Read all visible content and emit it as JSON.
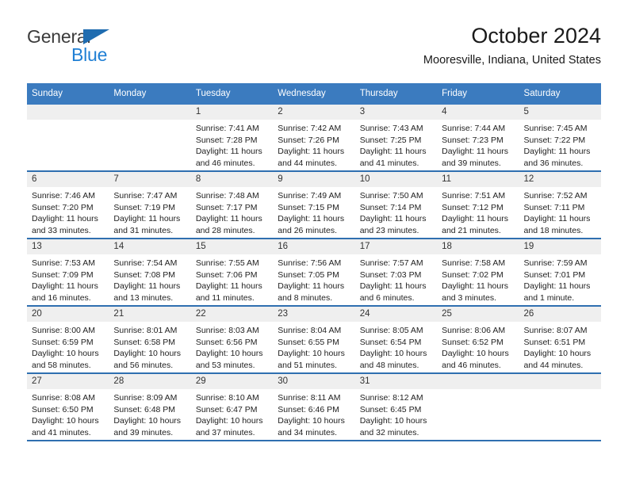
{
  "brand": {
    "name_top": "General",
    "name_bottom": "Blue",
    "triangle_color": "#1f6cb0",
    "text_color_top": "#3b3b3b",
    "text_color_bottom": "#1f7fd4"
  },
  "header": {
    "title": "October 2024",
    "subtitle": "Mooresville, Indiana, United States"
  },
  "theme": {
    "header_bg": "#3b7bbf",
    "row_border": "#2f6fb0",
    "daynum_bg": "#efefef",
    "page_bg": "#ffffff"
  },
  "labels": {
    "sunrise_prefix": "Sunrise:",
    "sunset_prefix": "Sunset:",
    "daylight_prefix": "Daylight:"
  },
  "weekdays": [
    "Sunday",
    "Monday",
    "Tuesday",
    "Wednesday",
    "Thursday",
    "Friday",
    "Saturday"
  ],
  "weeks": [
    [
      {
        "day": "",
        "empty": true,
        "sunrise": "",
        "sunset": "",
        "daylight_line1": "",
        "daylight_line2": ""
      },
      {
        "day": "",
        "empty": true,
        "sunrise": "",
        "sunset": "",
        "daylight_line1": "",
        "daylight_line2": ""
      },
      {
        "day": "1",
        "sunrise": "Sunrise: 7:41 AM",
        "sunset": "Sunset: 7:28 PM",
        "daylight_line1": "Daylight: 11 hours",
        "daylight_line2": "and 46 minutes."
      },
      {
        "day": "2",
        "sunrise": "Sunrise: 7:42 AM",
        "sunset": "Sunset: 7:26 PM",
        "daylight_line1": "Daylight: 11 hours",
        "daylight_line2": "and 44 minutes."
      },
      {
        "day": "3",
        "sunrise": "Sunrise: 7:43 AM",
        "sunset": "Sunset: 7:25 PM",
        "daylight_line1": "Daylight: 11 hours",
        "daylight_line2": "and 41 minutes."
      },
      {
        "day": "4",
        "sunrise": "Sunrise: 7:44 AM",
        "sunset": "Sunset: 7:23 PM",
        "daylight_line1": "Daylight: 11 hours",
        "daylight_line2": "and 39 minutes."
      },
      {
        "day": "5",
        "sunrise": "Sunrise: 7:45 AM",
        "sunset": "Sunset: 7:22 PM",
        "daylight_line1": "Daylight: 11 hours",
        "daylight_line2": "and 36 minutes."
      }
    ],
    [
      {
        "day": "6",
        "sunrise": "Sunrise: 7:46 AM",
        "sunset": "Sunset: 7:20 PM",
        "daylight_line1": "Daylight: 11 hours",
        "daylight_line2": "and 33 minutes."
      },
      {
        "day": "7",
        "sunrise": "Sunrise: 7:47 AM",
        "sunset": "Sunset: 7:19 PM",
        "daylight_line1": "Daylight: 11 hours",
        "daylight_line2": "and 31 minutes."
      },
      {
        "day": "8",
        "sunrise": "Sunrise: 7:48 AM",
        "sunset": "Sunset: 7:17 PM",
        "daylight_line1": "Daylight: 11 hours",
        "daylight_line2": "and 28 minutes."
      },
      {
        "day": "9",
        "sunrise": "Sunrise: 7:49 AM",
        "sunset": "Sunset: 7:15 PM",
        "daylight_line1": "Daylight: 11 hours",
        "daylight_line2": "and 26 minutes."
      },
      {
        "day": "10",
        "sunrise": "Sunrise: 7:50 AM",
        "sunset": "Sunset: 7:14 PM",
        "daylight_line1": "Daylight: 11 hours",
        "daylight_line2": "and 23 minutes."
      },
      {
        "day": "11",
        "sunrise": "Sunrise: 7:51 AM",
        "sunset": "Sunset: 7:12 PM",
        "daylight_line1": "Daylight: 11 hours",
        "daylight_line2": "and 21 minutes."
      },
      {
        "day": "12",
        "sunrise": "Sunrise: 7:52 AM",
        "sunset": "Sunset: 7:11 PM",
        "daylight_line1": "Daylight: 11 hours",
        "daylight_line2": "and 18 minutes."
      }
    ],
    [
      {
        "day": "13",
        "sunrise": "Sunrise: 7:53 AM",
        "sunset": "Sunset: 7:09 PM",
        "daylight_line1": "Daylight: 11 hours",
        "daylight_line2": "and 16 minutes."
      },
      {
        "day": "14",
        "sunrise": "Sunrise: 7:54 AM",
        "sunset": "Sunset: 7:08 PM",
        "daylight_line1": "Daylight: 11 hours",
        "daylight_line2": "and 13 minutes."
      },
      {
        "day": "15",
        "sunrise": "Sunrise: 7:55 AM",
        "sunset": "Sunset: 7:06 PM",
        "daylight_line1": "Daylight: 11 hours",
        "daylight_line2": "and 11 minutes."
      },
      {
        "day": "16",
        "sunrise": "Sunrise: 7:56 AM",
        "sunset": "Sunset: 7:05 PM",
        "daylight_line1": "Daylight: 11 hours",
        "daylight_line2": "and 8 minutes."
      },
      {
        "day": "17",
        "sunrise": "Sunrise: 7:57 AM",
        "sunset": "Sunset: 7:03 PM",
        "daylight_line1": "Daylight: 11 hours",
        "daylight_line2": "and 6 minutes."
      },
      {
        "day": "18",
        "sunrise": "Sunrise: 7:58 AM",
        "sunset": "Sunset: 7:02 PM",
        "daylight_line1": "Daylight: 11 hours",
        "daylight_line2": "and 3 minutes."
      },
      {
        "day": "19",
        "sunrise": "Sunrise: 7:59 AM",
        "sunset": "Sunset: 7:01 PM",
        "daylight_line1": "Daylight: 11 hours",
        "daylight_line2": "and 1 minute."
      }
    ],
    [
      {
        "day": "20",
        "sunrise": "Sunrise: 8:00 AM",
        "sunset": "Sunset: 6:59 PM",
        "daylight_line1": "Daylight: 10 hours",
        "daylight_line2": "and 58 minutes."
      },
      {
        "day": "21",
        "sunrise": "Sunrise: 8:01 AM",
        "sunset": "Sunset: 6:58 PM",
        "daylight_line1": "Daylight: 10 hours",
        "daylight_line2": "and 56 minutes."
      },
      {
        "day": "22",
        "sunrise": "Sunrise: 8:03 AM",
        "sunset": "Sunset: 6:56 PM",
        "daylight_line1": "Daylight: 10 hours",
        "daylight_line2": "and 53 minutes."
      },
      {
        "day": "23",
        "sunrise": "Sunrise: 8:04 AM",
        "sunset": "Sunset: 6:55 PM",
        "daylight_line1": "Daylight: 10 hours",
        "daylight_line2": "and 51 minutes."
      },
      {
        "day": "24",
        "sunrise": "Sunrise: 8:05 AM",
        "sunset": "Sunset: 6:54 PM",
        "daylight_line1": "Daylight: 10 hours",
        "daylight_line2": "and 48 minutes."
      },
      {
        "day": "25",
        "sunrise": "Sunrise: 8:06 AM",
        "sunset": "Sunset: 6:52 PM",
        "daylight_line1": "Daylight: 10 hours",
        "daylight_line2": "and 46 minutes."
      },
      {
        "day": "26",
        "sunrise": "Sunrise: 8:07 AM",
        "sunset": "Sunset: 6:51 PM",
        "daylight_line1": "Daylight: 10 hours",
        "daylight_line2": "and 44 minutes."
      }
    ],
    [
      {
        "day": "27",
        "sunrise": "Sunrise: 8:08 AM",
        "sunset": "Sunset: 6:50 PM",
        "daylight_line1": "Daylight: 10 hours",
        "daylight_line2": "and 41 minutes."
      },
      {
        "day": "28",
        "sunrise": "Sunrise: 8:09 AM",
        "sunset": "Sunset: 6:48 PM",
        "daylight_line1": "Daylight: 10 hours",
        "daylight_line2": "and 39 minutes."
      },
      {
        "day": "29",
        "sunrise": "Sunrise: 8:10 AM",
        "sunset": "Sunset: 6:47 PM",
        "daylight_line1": "Daylight: 10 hours",
        "daylight_line2": "and 37 minutes."
      },
      {
        "day": "30",
        "sunrise": "Sunrise: 8:11 AM",
        "sunset": "Sunset: 6:46 PM",
        "daylight_line1": "Daylight: 10 hours",
        "daylight_line2": "and 34 minutes."
      },
      {
        "day": "31",
        "sunrise": "Sunrise: 8:12 AM",
        "sunset": "Sunset: 6:45 PM",
        "daylight_line1": "Daylight: 10 hours",
        "daylight_line2": "and 32 minutes."
      },
      {
        "day": "",
        "empty": true,
        "sunrise": "",
        "sunset": "",
        "daylight_line1": "",
        "daylight_line2": ""
      },
      {
        "day": "",
        "empty": true,
        "sunrise": "",
        "sunset": "",
        "daylight_line1": "",
        "daylight_line2": ""
      }
    ]
  ]
}
